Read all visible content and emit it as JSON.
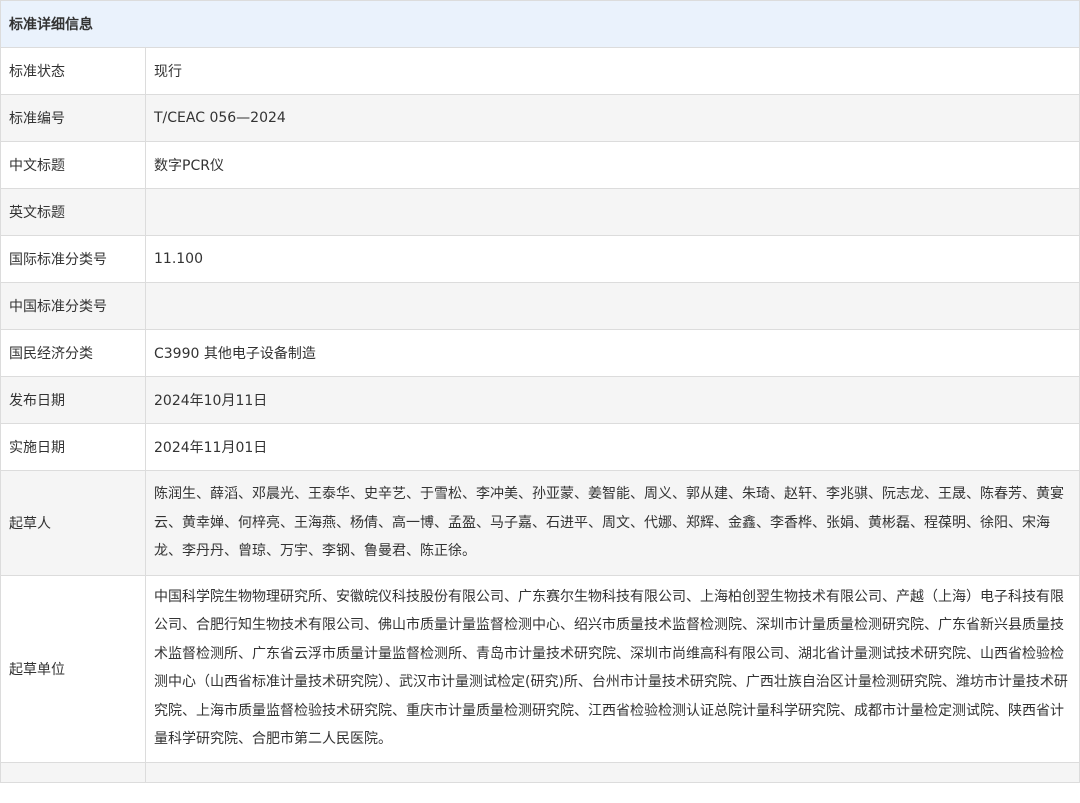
{
  "header": {
    "title": "标准详细信息"
  },
  "rows": [
    {
      "label": "标准状态",
      "value": "现行"
    },
    {
      "label": "标准编号",
      "value": "T/CEAC 056—2024"
    },
    {
      "label": "中文标题",
      "value": "数字PCR仪"
    },
    {
      "label": "英文标题",
      "value": ""
    },
    {
      "label": "国际标准分类号",
      "value": "11.100"
    },
    {
      "label": "中国标准分类号",
      "value": ""
    },
    {
      "label": "国民经济分类",
      "value": "C3990 其他电子设备制造"
    },
    {
      "label": "发布日期",
      "value": "2024年10月11日"
    },
    {
      "label": "实施日期",
      "value": "2024年11月01日"
    },
    {
      "label": "起草人",
      "value": "陈润生、薛滔、邓晨光、王泰华、史辛艺、于雪松、李冲美、孙亚蒙、姜智能、周义、郭从建、朱琦、赵轩、李兆骐、阮志龙、王晟、陈春芳、黄宴云、黄幸婵、何梓亮、王海燕、杨倩、高一博、孟盈、马子嘉、石进平、周文、代娜、郑辉、金鑫、李香桦、张娟、黄彬磊、程葆明、徐阳、宋海龙、李丹丹、曾琼、万宇、李钢、鲁曼君、陈正徐。"
    },
    {
      "label": "起草单位",
      "value": "中国科学院生物物理研究所、安徽皖仪科技股份有限公司、广东赛尔生物科技有限公司、上海柏创翌生物技术有限公司、产越（上海）电子科技有限公司、合肥行知生物技术有限公司、佛山市质量计量监督检测中心、绍兴市质量技术监督检测院、深圳市计量质量检测研究院、广东省新兴县质量技术监督检测所、广东省云浮市质量计量监督检测所、青岛市计量技术研究院、深圳市尚维高科有限公司、湖北省计量测试技术研究院、山西省检验检测中心（山西省标准计量技术研究院）、武汉市计量测试检定(研究)所、台州市计量技术研究院、广西壮族自治区计量检测研究院、潍坊市计量技术研究院、上海市质量监督检验技术研究院、重庆市计量质量检测研究院、江西省检验检测认证总院计量科学研究院、成都市计量检定测试院、陕西省计量科学研究院、合肥市第二人民医院。"
    }
  ]
}
